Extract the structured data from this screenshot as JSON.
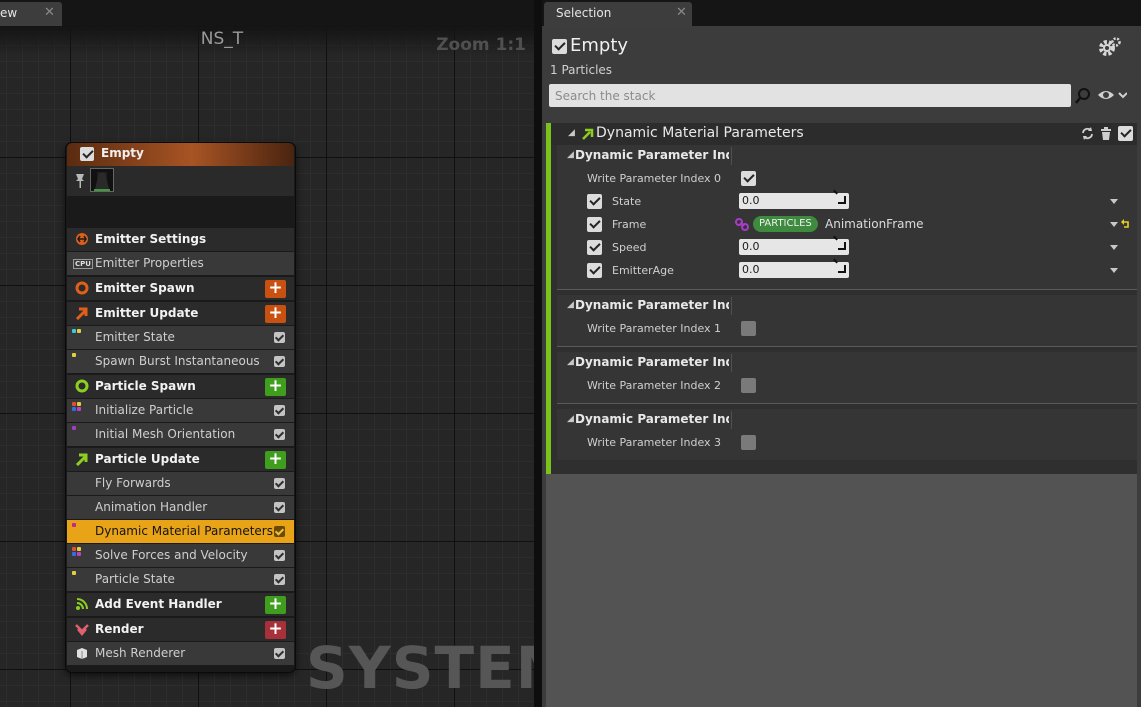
{
  "graph": {
    "tab_label": "ew",
    "tab_close": "✕",
    "title": "NS_T",
    "zoom": "Zoom 1:1",
    "watermark": "SYSTEM"
  },
  "node": {
    "title": "Empty",
    "rows": {
      "emitter_settings": "Emitter Settings",
      "emitter_properties": "Emitter Properties",
      "emitter_spawn": "Emitter Spawn",
      "emitter_update": "Emitter Update",
      "emitter_state": "Emitter State",
      "spawn_burst": "Spawn Burst Instantaneous",
      "particle_spawn": "Particle Spawn",
      "initialize_particle": "Initialize Particle",
      "initial_mesh_orientation": "Initial Mesh Orientation",
      "particle_update": "Particle Update",
      "fly_forwards": "Fly Forwards",
      "animation_handler": "Animation Handler",
      "dynamic_material_parameters": "Dynamic Material Parameters",
      "solve_forces": "Solve Forces and Velocity",
      "particle_state": "Particle State",
      "add_event_handler": "Add Event Handler",
      "render": "Render",
      "mesh_renderer": "Mesh Renderer"
    },
    "add_symbol": "+",
    "cpu_badge": "CPU"
  },
  "selection": {
    "tab_label": "Selection",
    "tab_close": "✕",
    "title": "Empty",
    "count": "1 Particles",
    "search_placeholder": "Search the stack",
    "module_title": "Dynamic Material Parameters",
    "sections": [
      {
        "title": "Dynamic Parameter Index",
        "write_label": "Write Parameter Index 0",
        "write_checked": true,
        "params": [
          {
            "label": "State",
            "value": "0.0"
          },
          {
            "label": "Frame",
            "badge": "PARTICLES",
            "link": "AnimationFrame"
          },
          {
            "label": "Speed",
            "value": "0.0"
          },
          {
            "label": "EmitterAge",
            "value": "0.0"
          }
        ]
      },
      {
        "title": "Dynamic Parameter Index",
        "write_label": "Write Parameter Index 1",
        "write_checked": false
      },
      {
        "title": "Dynamic Parameter Index",
        "write_label": "Write Parameter Index 2",
        "write_checked": false
      },
      {
        "title": "Dynamic Parameter Index",
        "write_label": "Write Parameter Index 3",
        "write_checked": false
      }
    ]
  },
  "colors": {
    "accent_green": "#7ac31a",
    "selected_row": "#e8a316",
    "emitter_orange": "#c85010",
    "particle_green": "#3f9e1e",
    "render_red": "#a8303a"
  }
}
